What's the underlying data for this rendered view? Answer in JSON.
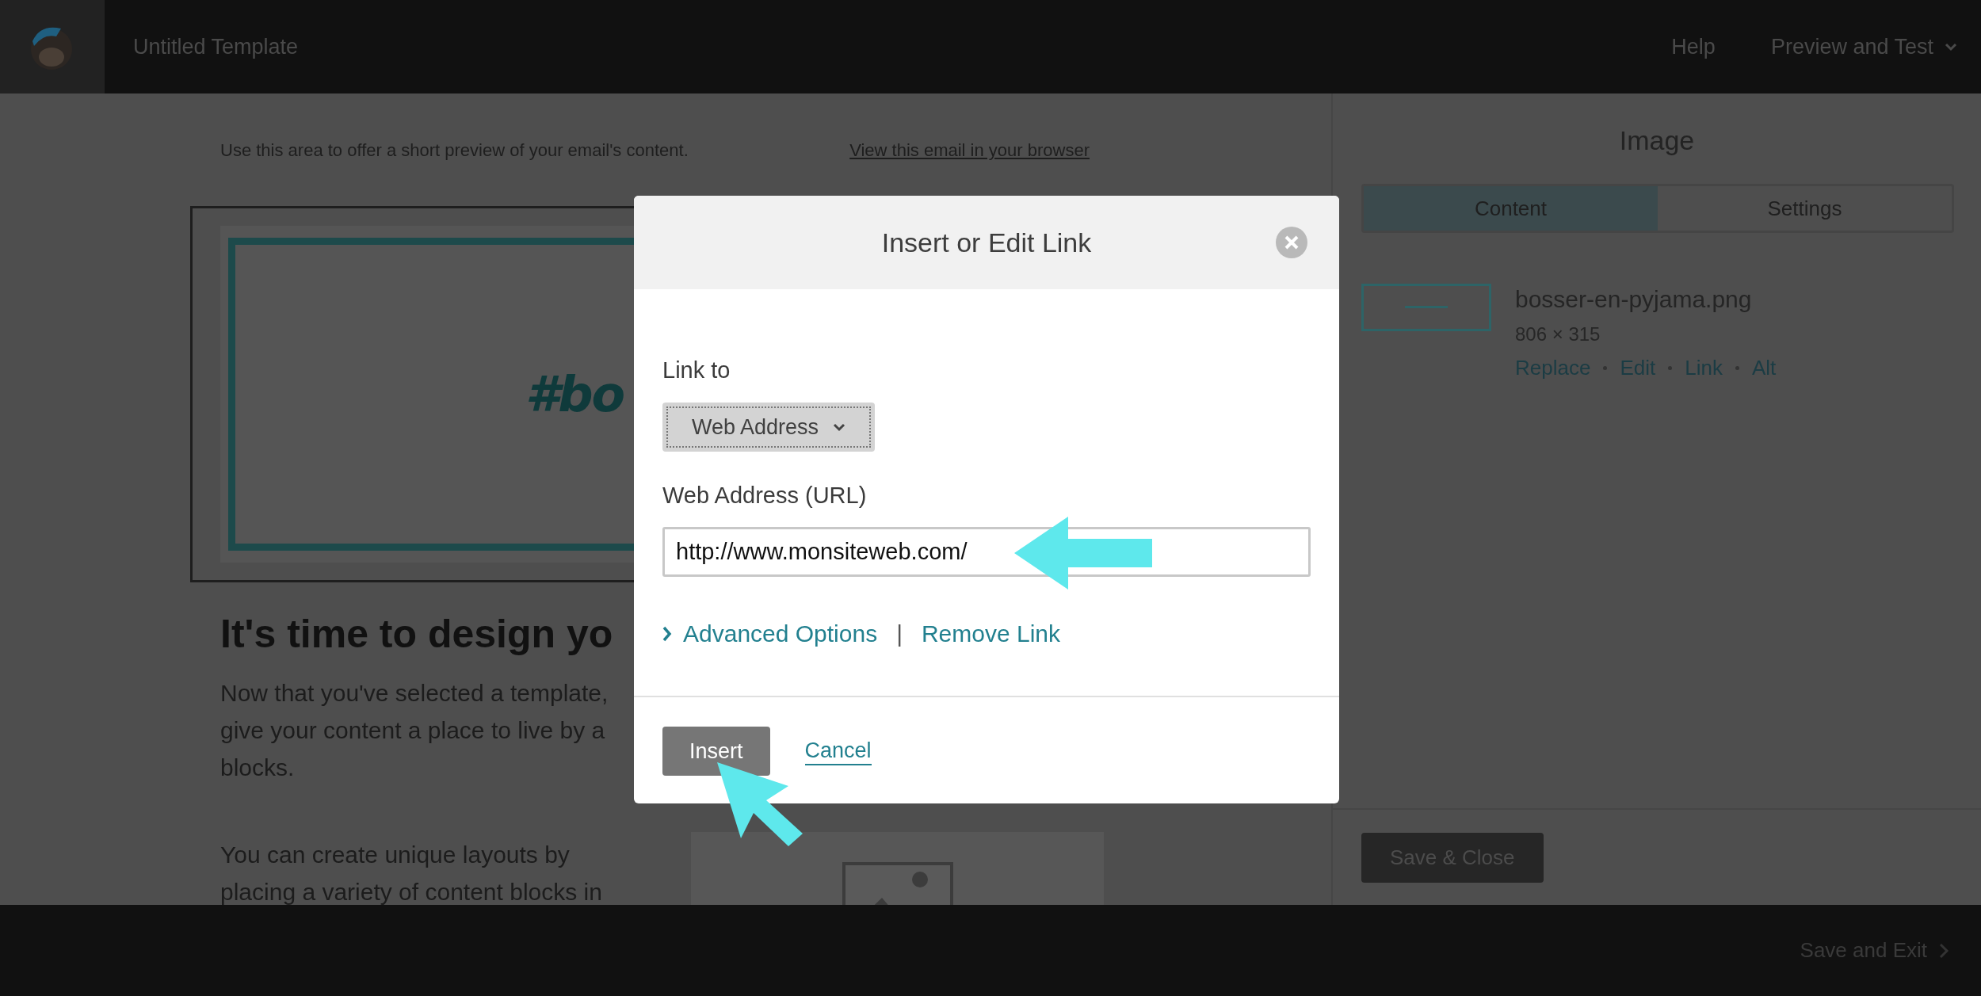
{
  "top_bar": {
    "title": "Untitled Template",
    "help": "Help",
    "preview_menu": "Preview and Test"
  },
  "email_preview": {
    "preheader": "Use this area to offer a short preview of your email's content.",
    "browser_link": "View this email in your browser",
    "banner_text": "#bo",
    "heading": "It's time to design yo",
    "paragraphs": [
      [
        "Now that you've selected a template,",
        "give your content a place to live by a",
        "blocks."
      ],
      [
        "You can create unique layouts by",
        "placing a variety of content blocks in"
      ]
    ]
  },
  "side_panel": {
    "title": "Image",
    "tabs": [
      {
        "label": "Content",
        "selected": true
      },
      {
        "label": "Settings",
        "selected": false
      }
    ],
    "file": {
      "name": "bosser-en-pyjama.png",
      "dimensions": "806 × 315",
      "actions": [
        "Replace",
        "Edit",
        "Link",
        "Alt"
      ]
    },
    "save_button": "Save & Close"
  },
  "dialog": {
    "title": "Insert or Edit Link",
    "link_to_label": "Link to",
    "link_type": "Web Address",
    "url_label": "Web Address (URL)",
    "url_value": "http://www.monsiteweb.com/",
    "advanced_options": "Advanced Options",
    "separator": "|",
    "remove_link": "Remove Link",
    "insert_button": "Insert",
    "cancel_link": "Cancel"
  },
  "bottom_bar": {
    "save_exit": "Save and Exit"
  }
}
